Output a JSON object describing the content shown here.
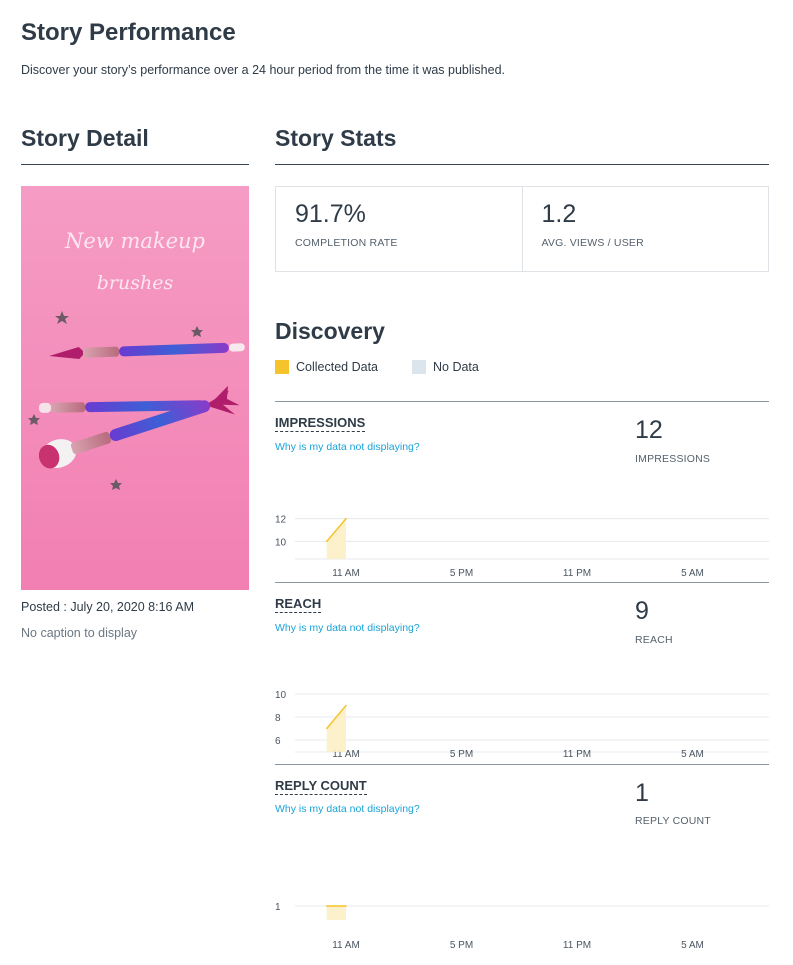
{
  "page": {
    "title": "Story Performance",
    "subtitle": "Discover your story’s performance over a 24 hour period from the time it was published."
  },
  "story_detail": {
    "heading": "Story Detail",
    "image_text_line1": "New makeup",
    "image_text_line2": "brushes",
    "posted": "Posted : July 20, 2020 8:16 AM",
    "caption": "No caption to display"
  },
  "story_stats": {
    "heading": "Story Stats",
    "completion_rate": {
      "value": "91.7%",
      "label": "COMPLETION RATE"
    },
    "avg_views": {
      "value": "1.2",
      "label": "AVG. VIEWS / USER"
    }
  },
  "discovery": {
    "heading": "Discovery",
    "legend": [
      {
        "label": "Collected Data",
        "color": "#f5c42c"
      },
      {
        "label": "No Data",
        "color": "#dce5ec"
      }
    ],
    "link_text": "Why is my data not displaying?"
  },
  "metrics": [
    {
      "title": "IMPRESSIONS",
      "value": "12",
      "label": "IMPRESSIONS"
    },
    {
      "title": "REACH",
      "value": "9",
      "label": "REACH"
    },
    {
      "title": "REPLY COUNT",
      "value": "1",
      "label": "REPLY COUNT"
    }
  ],
  "chart_data": [
    {
      "type": "area",
      "title": "",
      "x_ticks": [
        "11 AM",
        "5 PM",
        "11 PM",
        "5 AM"
      ],
      "y_ticks": [
        10,
        12
      ],
      "ylim": [
        9.5,
        12.5
      ],
      "series": [
        {
          "x": [
            "10 AM",
            "11 AM"
          ],
          "values": [
            10,
            12
          ]
        }
      ]
    },
    {
      "type": "area",
      "title": "",
      "x_ticks": [
        "11 AM",
        "5 PM",
        "11 PM",
        "5 AM"
      ],
      "y_ticks": [
        6,
        8,
        10
      ],
      "ylim": [
        6,
        10
      ],
      "series": [
        {
          "x": [
            "10 AM",
            "11 AM"
          ],
          "values": [
            7,
            9
          ]
        }
      ]
    },
    {
      "type": "area",
      "title": "",
      "x_ticks": [
        "11 AM",
        "5 PM",
        "11 PM",
        "5 AM"
      ],
      "y_ticks": [
        1
      ],
      "ylim": [
        0,
        1
      ],
      "series": [
        {
          "x": [
            "10 AM",
            "11 AM"
          ],
          "values": [
            1,
            1
          ]
        }
      ]
    }
  ]
}
